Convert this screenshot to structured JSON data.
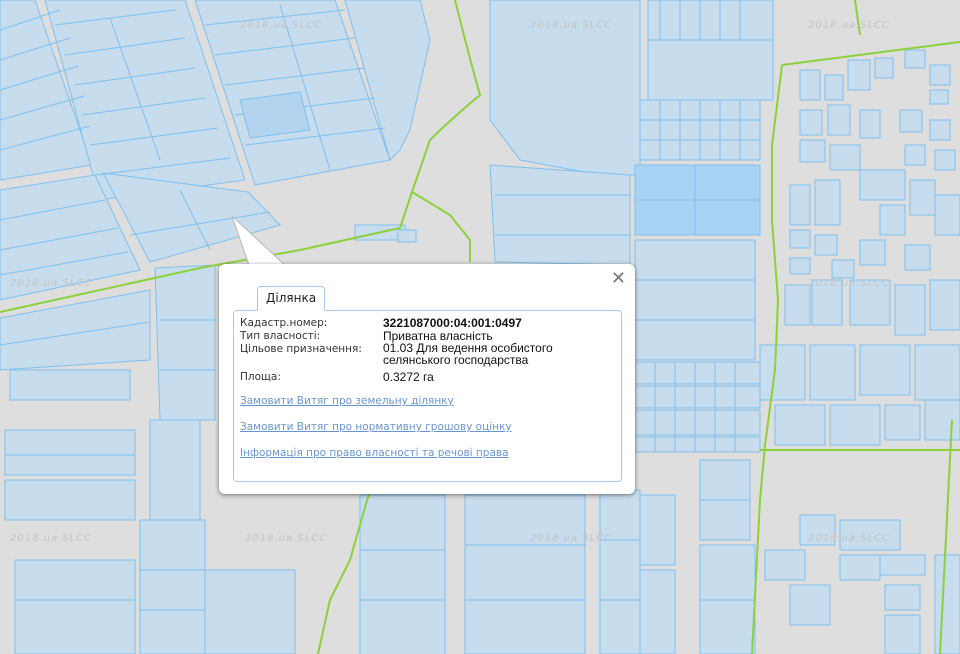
{
  "watermark": "2018.ua.SLCC",
  "colors": {
    "background": "#dedede",
    "parcel_fill": "#c7dced",
    "parcel_highlight": "#a9d3f5",
    "parcel_stroke": "#7fc0ee",
    "boundary_line": "#8dd13a"
  },
  "popup": {
    "tab_label": "Ділянка",
    "close_icon": "close-icon",
    "fields": {
      "cadastral_label": "Кадастр.номер:",
      "cadastral_value": "3221087000:04:001:0497",
      "ownership_label": "Тип власності:",
      "ownership_value": "Приватна власність",
      "purpose_label": "Цільове призначення:",
      "purpose_value": "01.03 Для ведення особистого селянського господарства",
      "area_label": "Площа:",
      "area_value": "0.3272 га"
    },
    "links": {
      "extract_land": "Замовити Витяг про земельну ділянку",
      "extract_valuation": "Замовити Витяг про нормативну грошову оцінку",
      "ownership_info": "Інформація про право власності та речові права"
    }
  }
}
